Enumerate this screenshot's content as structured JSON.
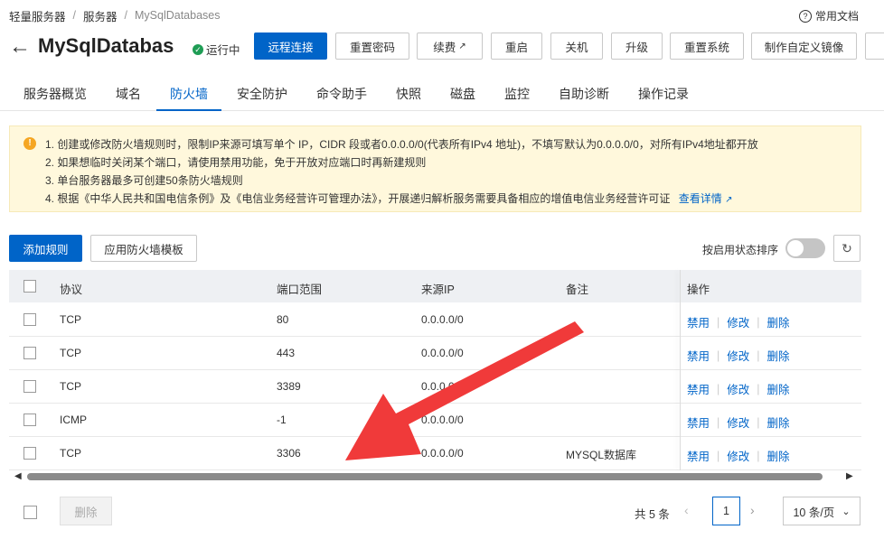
{
  "breadcrumb": [
    "轻量服务器",
    "服务器",
    "MySqlDatabases"
  ],
  "help_label": "常用文档",
  "title": "MySqlDatabas",
  "status": "运行中",
  "actions": [
    "远程连接",
    "重置密码",
    "续费",
    "重启",
    "关机",
    "升级",
    "重置系统",
    "制作自定义镜像"
  ],
  "tabs": [
    "服务器概览",
    "域名",
    "防火墙",
    "安全防护",
    "命令助手",
    "快照",
    "磁盘",
    "监控",
    "自助诊断",
    "操作记录"
  ],
  "active_tab": "防火墙",
  "notice": {
    "lines": [
      "1. 创建或修改防火墙规则时，限制IP来源可填写单个 IP，CIDR 段或者0.0.0.0/0(代表所有IPv4 地址)，不填写默认为0.0.0.0/0，对所有IPv4地址都开放",
      "2. 如果想临时关闭某个端口，请使用禁用功能，免于开放对应端口时再新建规则",
      "3. 单台服务器最多可创建50条防火墙规则",
      "4. 根据《中华人民共和国电信条例》及《电信业务经营许可管理办法》，开展递归解析服务需要具备相应的增值电信业务经营许可证"
    ],
    "link": "查看详情"
  },
  "toolbar": {
    "add": "添加规则",
    "template": "应用防火墙模板",
    "sort_label": "按启用状态排序"
  },
  "table": {
    "headers": [
      "协议",
      "端口范围",
      "来源IP",
      "备注",
      "操作"
    ],
    "rows": [
      {
        "protocol": "TCP",
        "port": "80",
        "source": "0.0.0.0/0",
        "note": ""
      },
      {
        "protocol": "TCP",
        "port": "443",
        "source": "0.0.0.0/0",
        "note": ""
      },
      {
        "protocol": "TCP",
        "port": "3389",
        "source": "0.0.0.0/0",
        "note": ""
      },
      {
        "protocol": "ICMP",
        "port": "-1",
        "source": "0.0.0.0/0",
        "note": ""
      },
      {
        "protocol": "TCP",
        "port": "3306",
        "source": "0.0.0.0/0",
        "note": "MYSQL数据库"
      }
    ],
    "ops": [
      "禁用",
      "修改",
      "删除"
    ]
  },
  "footer": {
    "delete": "删除",
    "total": "共 5 条",
    "page": "1",
    "page_size": "10 条/页"
  },
  "colors": {
    "primary": "#0064c8",
    "notice_bg": "#fff8dc",
    "annotation_arrow": "#f03a3a"
  }
}
